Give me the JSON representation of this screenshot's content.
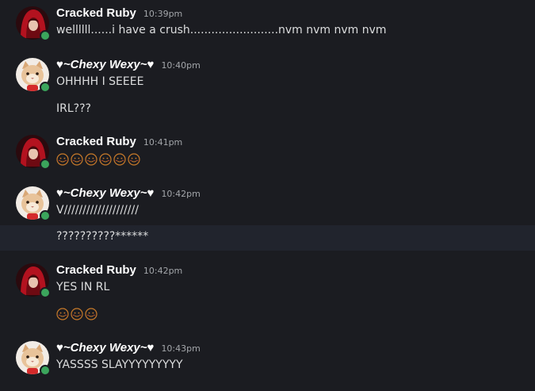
{
  "messages": [
    {
      "author": "Cracked Ruby",
      "time": "10:39pm",
      "lines": [
        "wellllll......i have a crush.........................nvm nvm nvm nvm"
      ]
    },
    {
      "author": "♥~Chexy Wexy~♥",
      "time": "10:40pm",
      "lines": [
        "OHHHH I SEEEE",
        "IRL???"
      ]
    },
    {
      "author": "Cracked Ruby",
      "time": "10:41pm",
      "emoji_count": 6
    },
    {
      "author": "♥~Chexy Wexy~♥",
      "time": "10:42pm",
      "lines": [
        "V////////////////////",
        "??????????******"
      ]
    },
    {
      "author": "Cracked Ruby",
      "time": "10:42pm",
      "lines": [
        "YES IN RL"
      ],
      "emoji_count": 3
    },
    {
      "author": "♥~Chexy Wexy~♥",
      "time": "10:43pm",
      "lines": [
        "YASSSS SLAYYYYYYYYY"
      ]
    }
  ],
  "emoji_name": "blushing-face-emoji",
  "colors": {
    "background": "#1b1c21",
    "hover_row": "#21242d",
    "online_status": "#3ba55c",
    "username": "#ffffff",
    "message_text": "#dcddde",
    "timestamp": "#a3a6aa"
  }
}
